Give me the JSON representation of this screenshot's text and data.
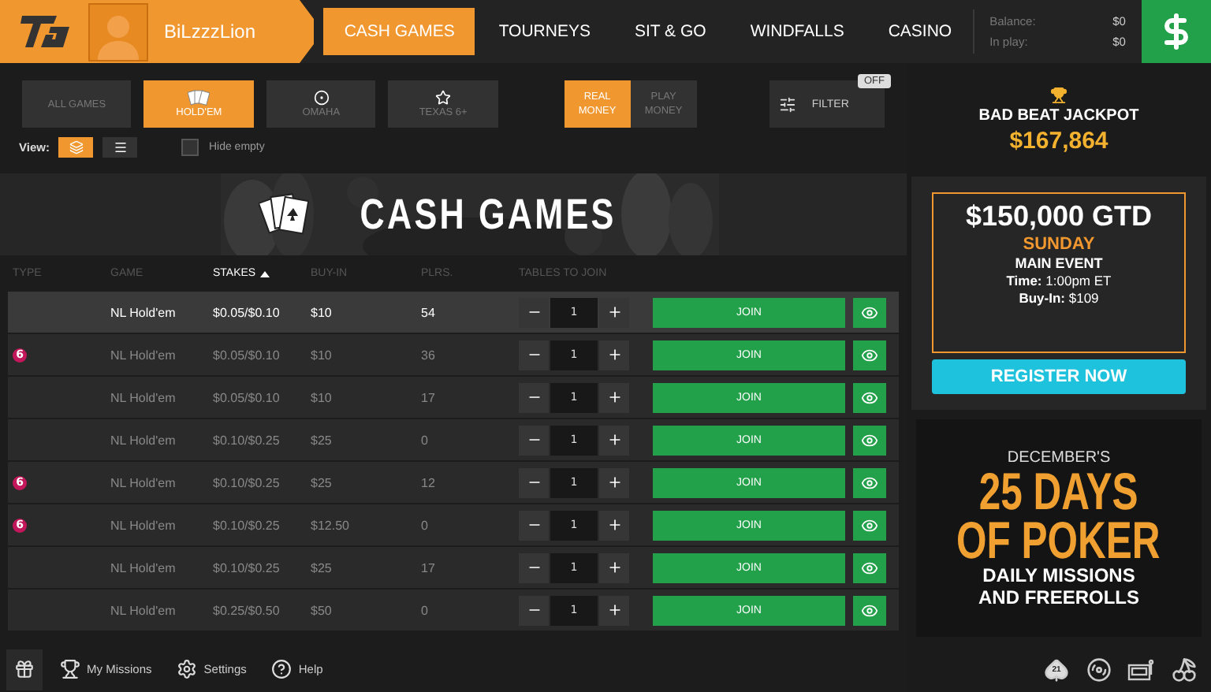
{
  "user": {
    "name": "BiLzzzLion"
  },
  "nav": [
    {
      "label": "CASH GAMES",
      "selected": true
    },
    {
      "label": "TOURNEYS",
      "selected": false
    },
    {
      "label": "SIT & GO",
      "selected": false
    },
    {
      "label": "WINDFALLS",
      "selected": false
    },
    {
      "label": "CASINO",
      "selected": false
    }
  ],
  "balance": [
    {
      "label": "Balance:",
      "value": "$0"
    },
    {
      "label": "In play:",
      "value": "$0"
    }
  ],
  "game_filters": [
    {
      "kind": "none",
      "label": "ALL GAMES",
      "selected": false
    },
    {
      "kind": "cards",
      "label": "HOLD'EM",
      "selected": true
    },
    {
      "kind": "target",
      "label": "OMAHA",
      "selected": false
    },
    {
      "kind": "star",
      "label": "TEXAS 6+",
      "selected": false
    }
  ],
  "money": [
    {
      "label": "REAL MONEY",
      "selected": true
    },
    {
      "label": "PLAY MONEY",
      "selected": false
    }
  ],
  "filter": {
    "label": "FILTER",
    "badge": "OFF"
  },
  "view": {
    "label": "View:",
    "modes": [
      {
        "kind": "stack",
        "selected": true
      },
      {
        "kind": "list",
        "selected": false
      }
    ],
    "hide_empty": {
      "label": "Hide empty",
      "checked": false
    }
  },
  "banner": {
    "title": "CASH GAMES"
  },
  "table": {
    "columns": [
      {
        "label": "TYPE",
        "sorted": false
      },
      {
        "label": "GAME",
        "sorted": false
      },
      {
        "label": "STAKES",
        "sorted": true
      },
      {
        "label": "BUY-IN",
        "sorted": false
      },
      {
        "label": "PLRS.",
        "sorted": false
      },
      {
        "label": "TABLES TO JOIN",
        "sorted": false
      }
    ],
    "rows": [
      {
        "game": "NL Hold'em",
        "stakes": "$0.05/$0.10",
        "buyin": "$10",
        "players": "54",
        "tables": "1",
        "action": "JOIN",
        "selected": true
      },
      {
        "badge": "6",
        "game": "NL Hold'em",
        "stakes": "$0.05/$0.10",
        "buyin": "$10",
        "players": "36",
        "tables": "1",
        "action": "JOIN",
        "selected": false
      },
      {
        "game": "NL Hold'em",
        "stakes": "$0.05/$0.10",
        "buyin": "$10",
        "players": "17",
        "tables": "1",
        "action": "JOIN",
        "selected": false
      },
      {
        "game": "NL Hold'em",
        "stakes": "$0.10/$0.25",
        "buyin": "$25",
        "players": "0",
        "tables": "1",
        "action": "JOIN",
        "selected": false
      },
      {
        "badge": "6",
        "game": "NL Hold'em",
        "stakes": "$0.10/$0.25",
        "buyin": "$25",
        "players": "12",
        "tables": "1",
        "action": "JOIN",
        "selected": false
      },
      {
        "badge": "6",
        "game": "NL Hold'em",
        "stakes": "$0.10/$0.25",
        "buyin": "$12.50",
        "players": "0",
        "tables": "1",
        "action": "JOIN",
        "selected": false
      },
      {
        "game": "NL Hold'em",
        "stakes": "$0.10/$0.25",
        "buyin": "$25",
        "players": "17",
        "tables": "1",
        "action": "JOIN",
        "selected": false
      },
      {
        "game": "NL Hold'em",
        "stakes": "$0.25/$0.50",
        "buyin": "$50",
        "players": "0",
        "tables": "1",
        "action": "JOIN",
        "selected": false
      }
    ]
  },
  "jackpot": {
    "title": "BAD BEAT JACKPOT",
    "amount": "$167,864"
  },
  "promo": {
    "amount": "$150,000 GTD",
    "day": "SUNDAY",
    "event": "MAIN EVENT",
    "time_label": "Time:",
    "time": "1:00pm ET",
    "buyin_label": "Buy-In:",
    "buyin": "$109",
    "button": "REGISTER NOW"
  },
  "promo2": {
    "eyebrow": "DECEMBER'S",
    "headline": [
      "25 DAYS",
      "OF POKER"
    ],
    "sub": [
      "DAILY MISSIONS",
      "AND FREEROLLS"
    ]
  },
  "footer": {
    "items": [
      {
        "kind": "gift"
      },
      {
        "kind": "trophy",
        "label": "My Missions"
      },
      {
        "kind": "gear",
        "label": "Settings"
      },
      {
        "kind": "help",
        "label": "Help"
      }
    ],
    "games": [
      {
        "kind": "spade",
        "label": "21"
      },
      {
        "kind": "chip"
      },
      {
        "kind": "slot"
      },
      {
        "kind": "cherry"
      }
    ]
  }
}
